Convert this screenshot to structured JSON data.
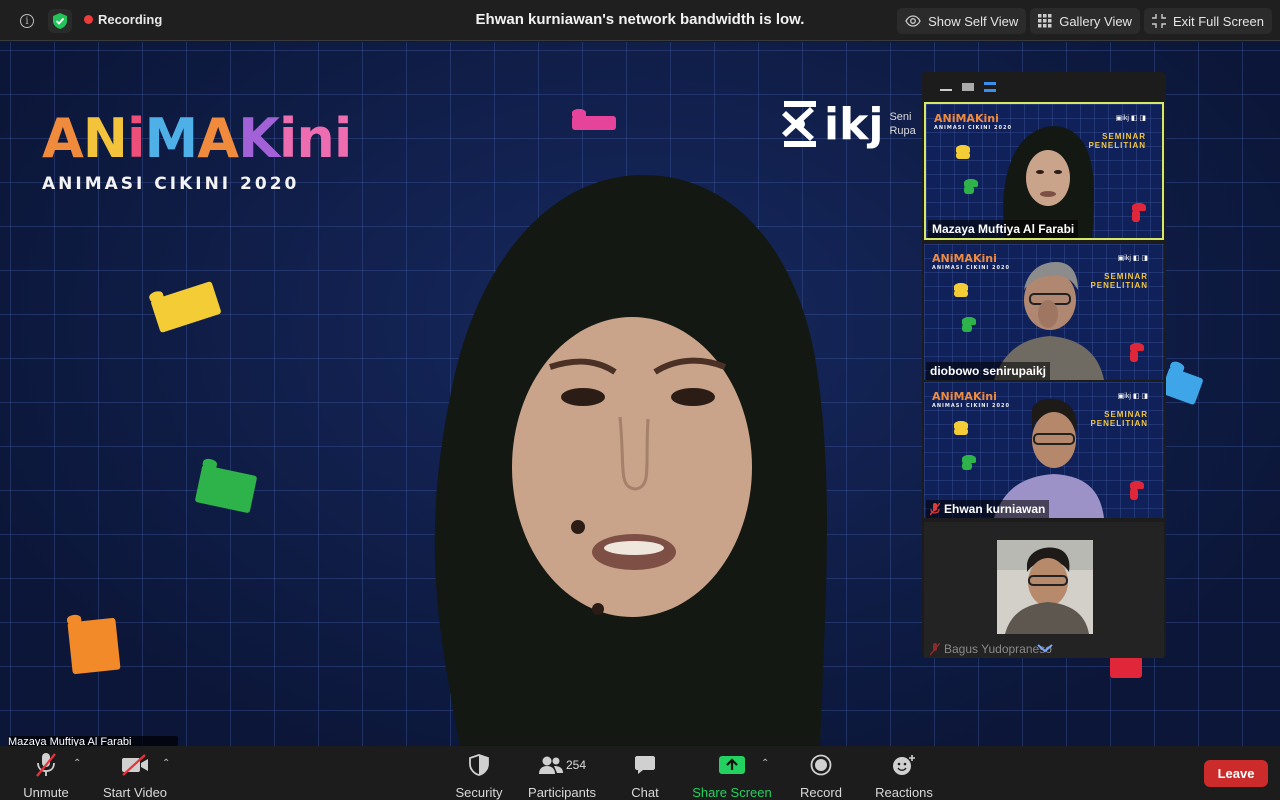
{
  "topbar": {
    "recording_label": "Recording",
    "notice": "Ehwan kurniawan's network bandwidth is low.",
    "buttons": [
      {
        "label": "Show Self View",
        "icon": "eye-icon"
      },
      {
        "label": "Gallery View",
        "icon": "grid-icon"
      },
      {
        "label": "Exit Full Screen",
        "icon": "exit-fullscreen-icon"
      }
    ]
  },
  "stage": {
    "brand_word": "ANiMAKini",
    "brand_sub": "ANIMASI CIKINI 2020",
    "ikj_text": "ikj",
    "ikj_side": "Seni",
    "ikj_side2": "Rupa",
    "speaker_name": "Mazaya Muftiya Al Farabi"
  },
  "panel": {
    "tiles": [
      {
        "name": "Mazaya Muftiya Al Farabi",
        "active": true,
        "muted": false
      },
      {
        "name": "diobowo senirupaikj",
        "active": false,
        "muted": false
      },
      {
        "name": "Ehwan kurniawan",
        "active": false,
        "muted": true
      },
      {
        "name": "Bagus Yudopraneso",
        "active": false,
        "muted": true
      }
    ],
    "tile_brand": "ANiMAKini",
    "tile_brand_sub": "ANIMASI CIKINI 2020",
    "tile_seminar_1": "SEMINAR",
    "tile_seminar_2": "PENELITIAN"
  },
  "bottombar": {
    "unmute": "Unmute",
    "start_video": "Start Video",
    "security": "Security",
    "participants": "Participants",
    "participants_count": "254",
    "chat": "Chat",
    "share_screen": "Share Screen",
    "record": "Record",
    "reactions": "Reactions",
    "leave": "Leave"
  },
  "colors": {
    "share_green": "#23d160",
    "leave_red": "#cc2b2b",
    "recording_red": "#ee3b3b",
    "active_border": "#d6e86a"
  }
}
